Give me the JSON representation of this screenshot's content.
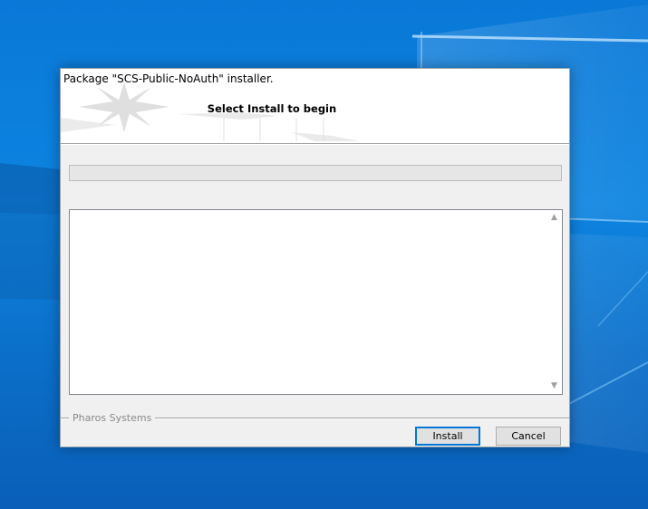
{
  "window": {
    "title": "Package \"SCS-Public-NoAuth\" installer.",
    "heading": "Select Install to begin"
  },
  "progress": {
    "value": 0
  },
  "log": {
    "text": ""
  },
  "footer": {
    "brand": "Pharos Systems"
  },
  "buttons": {
    "install": "Install",
    "cancel": "Cancel"
  },
  "icons": {
    "scroll_up": "scroll-up-arrow-icon",
    "scroll_down": "scroll-down-arrow-icon",
    "banner_art": "compass-rose-icon"
  },
  "colors": {
    "desktop": "#0a78d7",
    "focus_border": "#0078d7",
    "dialog_bg": "#f0f0f0"
  }
}
